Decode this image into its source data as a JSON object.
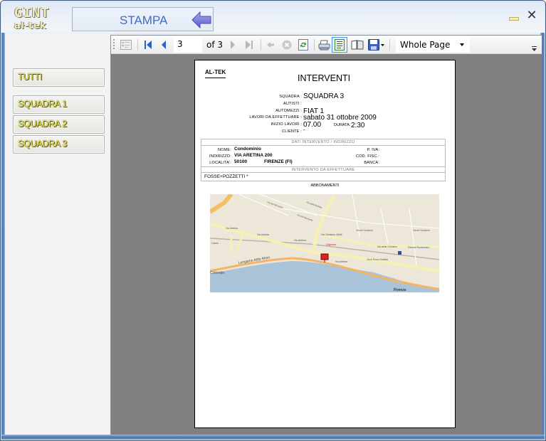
{
  "window": {
    "logo_top": "GINT",
    "logo_bottom": "al-tek",
    "header_title": "STAMPA",
    "controls": {
      "minimize_icon": "minimize-icon",
      "close_icon": "close-icon",
      "close_glyph": "✕"
    }
  },
  "sidebar": {
    "items": [
      {
        "label": "TUTTI"
      },
      {
        "label": "SQUADRA 1"
      },
      {
        "label": "SQUADRA 2"
      },
      {
        "label": "SQUADRA 3"
      }
    ]
  },
  "toolbar": {
    "current_page": "3",
    "of_label": "of",
    "total_pages": "3",
    "zoom_value": "Whole Page",
    "buttons": [
      "document-map-icon",
      "first-page-icon",
      "previous-page-icon",
      "next-page-icon",
      "last-page-icon",
      "back-icon",
      "stop-icon",
      "refresh-icon",
      "print-icon",
      "print-layout-icon",
      "page-setup-icon",
      "export-icon"
    ]
  },
  "report": {
    "brand": "AL-TEK",
    "title": "INTERVENTI",
    "fields": [
      {
        "label": "SQUADRA :",
        "value": "SQUADRA 3"
      },
      {
        "label": "AUTISTI :",
        "value": ""
      },
      {
        "label": "AUTOMEZZI :",
        "value": "FIAT 1"
      },
      {
        "label": "LAVORI DA EFFETTUARE :",
        "value": "sabato 31 ottobre 2009"
      },
      {
        "label": "INIZIO LAVORI :",
        "value": "07.00"
      },
      {
        "label": "CLIENTE :",
        "value": "-"
      }
    ],
    "durata_label": "DURATA:",
    "durata_value": "2:30",
    "address_section": {
      "header": "DATI INTERVENTO / INDIRIZZO",
      "nome_label": "NOME:",
      "nome_value": "Condominio",
      "indirizzo_label": "INDIRIZZO:",
      "indirizzo_value": "VIA ARETINA 200",
      "localita_label": "LOCALITA':",
      "cap_value": "50100",
      "citta_value": "FIRENZE (FI)",
      "piva_label": "P. IVA:",
      "codfisc_label": "COD. FISC.:",
      "banca_label": "BANCA:"
    },
    "work_section": {
      "header": "INTERVENTO DA EFFETTUARE",
      "text": "FOSSE+POZZETTI *"
    },
    "abbonamenti_label": "ABBONAMENTI",
    "map": {
      "labels": {
        "aretina1": "Via Aretina",
        "aretina2": "Via Aretina",
        "aretina3": "Via Aretina",
        "aretina4": "Via Aretina",
        "lungarno": "Lungarno Aldo Moro",
        "colombo": "Colombo",
        "gignoro": "Gignoro",
        "girolamo": "Via Girolamo Vitelli",
        "chiantigiana": "Via della Chimera",
        "guarlone": "Via del Guarlone",
        "guarlone2": "Via del Guarlone",
        "rocca": "Via di Rocca Tedalda",
        "station": "Firenze Rovezzano",
        "firenze": "Firenze",
        "lanza": "Lanza",
        "mezzetta": "Via del Mezzetta",
        "mezzetta2": "Via del Mezzetta",
        "robbia": "Via della Robbia"
      }
    }
  }
}
